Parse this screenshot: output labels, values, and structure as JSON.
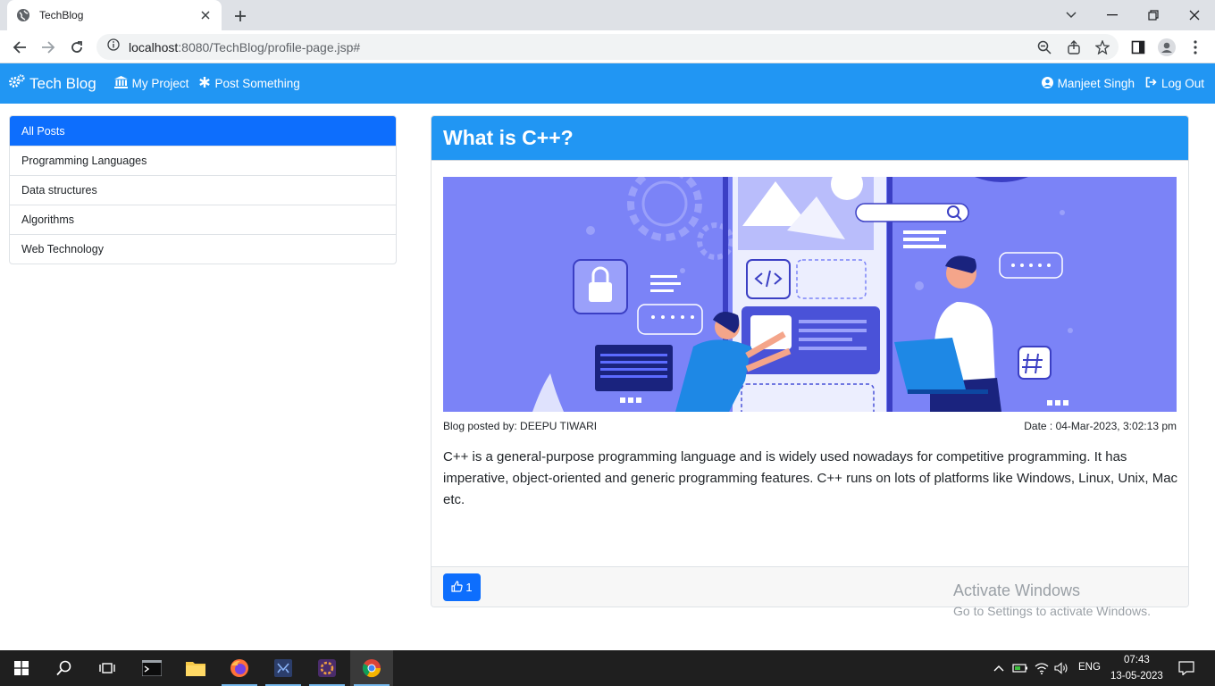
{
  "browser": {
    "tab_title": "TechBlog",
    "url_host": "localhost",
    "url_rest": ":8080/TechBlog/profile-page.jsp#"
  },
  "navbar": {
    "brand": "Tech Blog",
    "links": [
      "My Project",
      "Post Something"
    ],
    "user": "Manjeet Singh",
    "logout": "Log Out"
  },
  "sidebar": {
    "items": [
      {
        "label": "All Posts",
        "active": true
      },
      {
        "label": "Programming Languages",
        "active": false
      },
      {
        "label": "Data structures",
        "active": false
      },
      {
        "label": "Algorithms",
        "active": false
      },
      {
        "label": "Web Technology",
        "active": false
      }
    ]
  },
  "post": {
    "title": "What is C++?",
    "posted_by": "Blog posted by: DEEPU TIWARI",
    "date": "Date : 04-Mar-2023, 3:02:13 pm",
    "content": "C++ is a general-purpose programming language and is widely used nowadays for competitive programming. It has imperative, object-oriented and generic programming features. C++ runs on lots of platforms like Windows, Linux, Unix, Mac etc.",
    "likes": "1"
  },
  "watermark": {
    "line1": "Activate Windows",
    "line2": "Go to Settings to activate Windows."
  },
  "taskbar": {
    "lang": "ENG",
    "time": "07:43",
    "date": "13-05-2023"
  },
  "colors": {
    "navbar": "#2196f3",
    "active_item": "#0d6efd",
    "illustration_bg": "#7b83f7"
  }
}
